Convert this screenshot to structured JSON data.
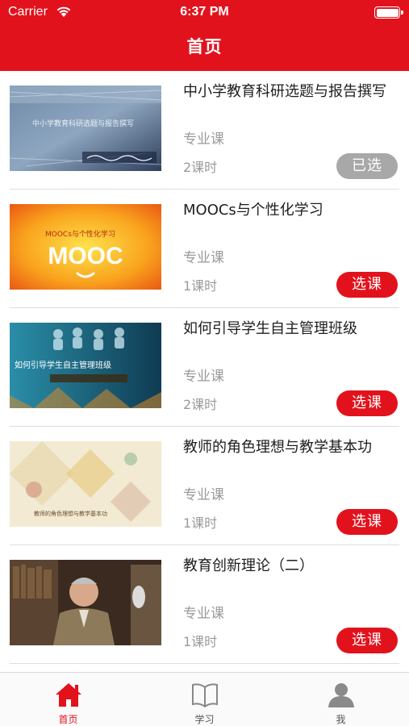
{
  "status_bar": {
    "carrier": "Carrier",
    "time": "6:37 PM"
  },
  "nav": {
    "title": "首页"
  },
  "courses": [
    {
      "title": "中小学教育科研选题与报告撰写",
      "type": "专业课",
      "hours": "2课时",
      "button": "已选",
      "selected": true,
      "thumb_text": "中小学教育科研选题与报告撰写"
    },
    {
      "title": "MOOCs与个性化学习",
      "type": "专业课",
      "hours": "1课时",
      "button": "选课",
      "selected": false,
      "thumb_text": "MOOCs与个性化学习",
      "thumb_logo": "MOOC"
    },
    {
      "title": "如何引导学生自主管理班级",
      "type": "专业课",
      "hours": "2课时",
      "button": "选课",
      "selected": false,
      "thumb_text": "如何引导学生自主管理班级"
    },
    {
      "title": "教师的角色理想与教学基本功",
      "type": "专业课",
      "hours": "1课时",
      "button": "选课",
      "selected": false,
      "thumb_text": "教师的角色理想与教学基本功"
    },
    {
      "title": "教育创新理论（二）",
      "type": "专业课",
      "hours": "1课时",
      "button": "选课",
      "selected": false
    }
  ],
  "tabbar": [
    {
      "label": "首页",
      "icon": "home-icon",
      "active": true
    },
    {
      "label": "学习",
      "icon": "book-icon",
      "active": false
    },
    {
      "label": "我",
      "icon": "person-icon",
      "active": false
    }
  ],
  "colors": {
    "brand": "#e2121c",
    "selected_button": "#a8a8a8",
    "muted_text": "#9a9a9a"
  }
}
